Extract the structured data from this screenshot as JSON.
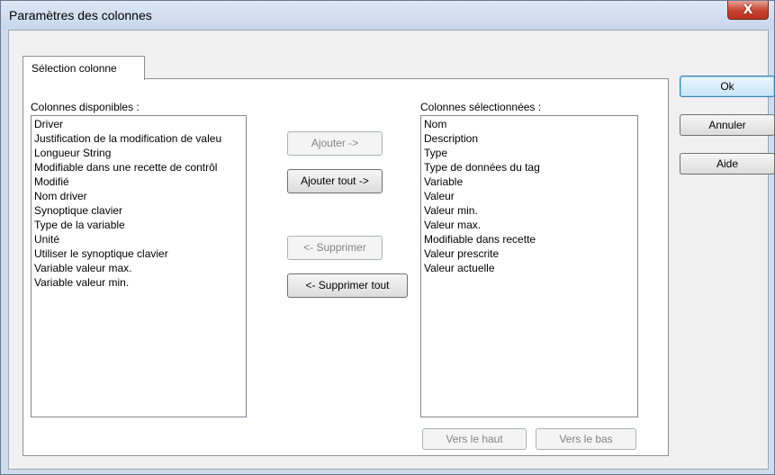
{
  "window": {
    "title": "Paramètres des colonnes",
    "close_glyph": "X"
  },
  "tab": {
    "label": "Sélection colonne"
  },
  "available": {
    "label": "Colonnes disponibles :",
    "items": [
      "Driver",
      "Justification de la modification de valeu",
      "Longueur String",
      "Modifiable dans une recette de contrôl",
      "Modifié",
      "Nom driver",
      "Synoptique clavier",
      "Type de la variable",
      "Unité",
      "Utiliser le synoptique clavier",
      "Variable valeur max.",
      "Variable valeur min."
    ]
  },
  "selected": {
    "label": "Colonnes sélectionnées :",
    "items": [
      "Nom",
      "Description",
      "Type",
      "Type de données du tag",
      "Variable",
      "Valeur",
      "Valeur min.",
      "Valeur max.",
      "Modifiable dans recette",
      "Valeur prescrite",
      "Valeur actuelle"
    ]
  },
  "buttons": {
    "ajouter": "Ajouter ->",
    "ajouter_tout": "Ajouter tout ->",
    "supprimer": "<- Supprimer",
    "supprimer_tout": "<- Supprimer tout",
    "vers_haut": "Vers le haut",
    "vers_bas": "Vers le bas",
    "ok": "Ok",
    "annuler": "Annuler",
    "aide": "Aide"
  }
}
